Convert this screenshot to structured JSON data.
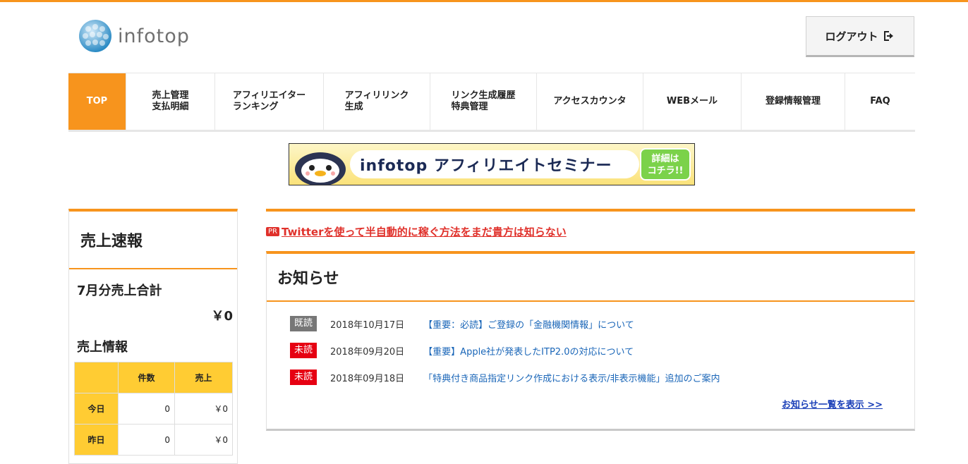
{
  "header": {
    "logo_text": "infotop",
    "logout_label": "ログアウト"
  },
  "nav": {
    "items": [
      {
        "line1": "TOP",
        "line2": ""
      },
      {
        "line1": "売上管理",
        "line2": "支払明細"
      },
      {
        "line1": "アフィリエイター",
        "line2": "ランキング"
      },
      {
        "line1": "アフィリリンク",
        "line2": "生成"
      },
      {
        "line1": "リンク生成履歴",
        "line2": "特典管理"
      },
      {
        "line1": "アクセスカウンタ",
        "line2": ""
      },
      {
        "line1": "WEBメール",
        "line2": ""
      },
      {
        "line1": "登録情報管理",
        "line2": ""
      },
      {
        "line1": "FAQ",
        "line2": ""
      }
    ]
  },
  "banner": {
    "title": "infotop アフィリエイトセミナー",
    "cta_line1": "詳細は",
    "cta_line2": "コチラ!!"
  },
  "sidebar": {
    "title": "売上速報",
    "month_total_label": "7月分売上合計",
    "month_total_value": "￥0",
    "sales_info_label": "売上情報",
    "table": {
      "headers": [
        "",
        "件数",
        "売上"
      ],
      "rows": [
        {
          "label": "今日",
          "count": "0",
          "sales": "￥0"
        },
        {
          "label": "昨日",
          "count": "0",
          "sales": "￥0"
        }
      ]
    }
  },
  "main": {
    "pr": {
      "badge": "PR",
      "text": "Twitterを使って半自動的に稼ぐ方法をまだ貴方は知らない"
    },
    "news": {
      "title": "お知らせ",
      "items": [
        {
          "status": "既読",
          "date": "2018年10月17日",
          "title": "【重要：必読】ご登録の「金融機関情報」について"
        },
        {
          "status": "未読",
          "date": "2018年09月20日",
          "title": "【重要】Apple社が発表したITP2.0の対応について"
        },
        {
          "status": "未読",
          "date": "2018年09月18日",
          "title": "「特典付き商品指定リンク作成における表示/非表示機能」追加のご案内"
        }
      ],
      "more_link": "お知らせ一覧を表示 >>"
    }
  },
  "colors": {
    "accent": "#f7941d",
    "table_header": "#ffcc33",
    "unread": "#e60012",
    "read": "#777777",
    "link": "#1a66b8"
  }
}
